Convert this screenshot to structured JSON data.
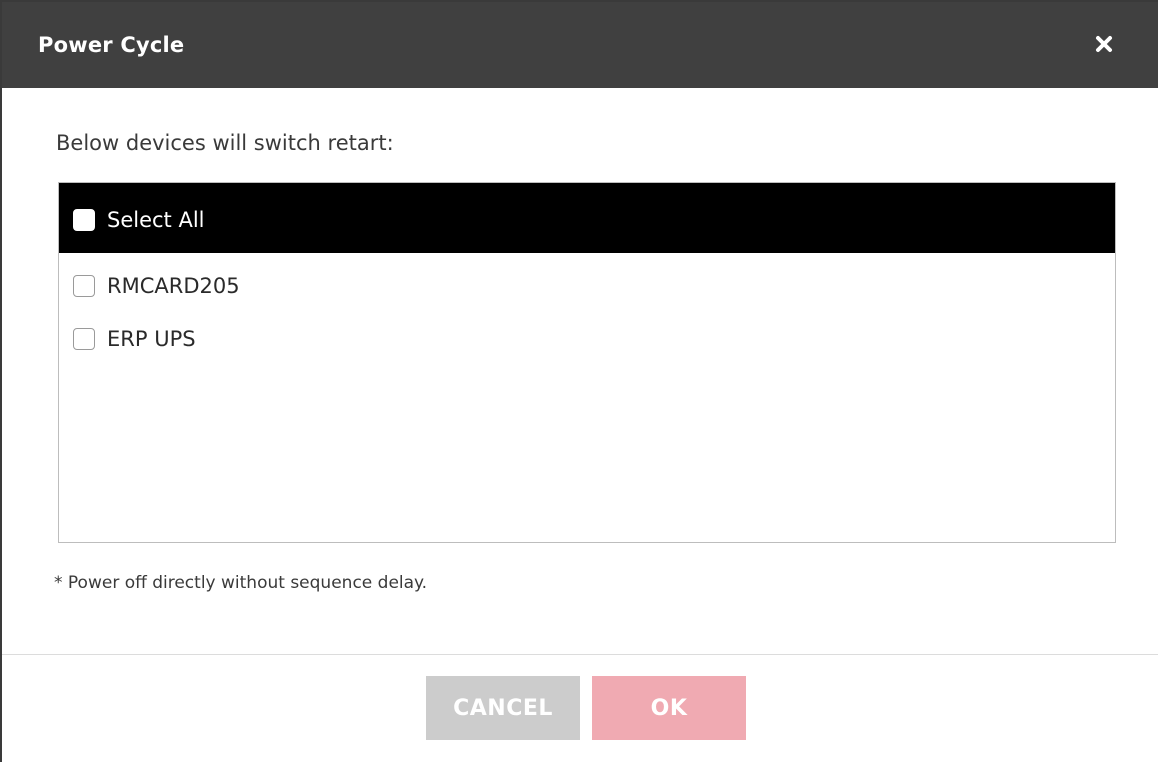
{
  "dialog": {
    "title": "Power Cycle",
    "close_icon": "close-icon",
    "intro_text": "Below devices will switch retart:",
    "select_all": {
      "label": "Select All",
      "checked": false
    },
    "devices": [
      {
        "label": "RMCARD205",
        "checked": false
      },
      {
        "label": "ERP UPS",
        "checked": false
      }
    ],
    "note": "* Power off directly without sequence delay.",
    "buttons": {
      "cancel_label": "CANCEL",
      "ok_label": "OK"
    },
    "colors": {
      "titlebar": "#404040",
      "list_header": "#000000",
      "cancel_button": "#cccccc",
      "ok_button": "#f0aab2"
    }
  }
}
